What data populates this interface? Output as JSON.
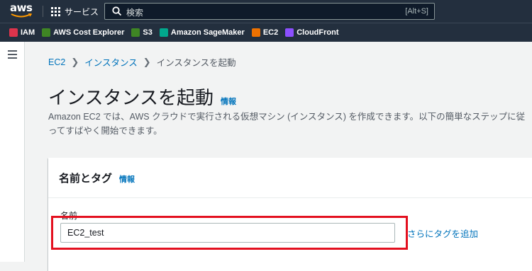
{
  "topbar": {
    "logo_text": "aws",
    "services_label": "サービス",
    "search_placeholder": "検索",
    "search_shortcut": "[Alt+S]"
  },
  "favorites": [
    {
      "label": "IAM",
      "icon": "iam-icon",
      "color": "#dd344c"
    },
    {
      "label": "AWS Cost Explorer",
      "icon": "cost-explorer-icon",
      "color": "#3f8624"
    },
    {
      "label": "S3",
      "icon": "s3-icon",
      "color": "#3f8624"
    },
    {
      "label": "Amazon SageMaker",
      "icon": "sagemaker-icon",
      "color": "#01a88d"
    },
    {
      "label": "EC2",
      "icon": "ec2-icon",
      "color": "#ed7100"
    },
    {
      "label": "CloudFront",
      "icon": "cloudfront-icon",
      "color": "#8c4fff"
    }
  ],
  "breadcrumb": {
    "items": [
      "EC2",
      "インスタンス",
      "インスタンスを起動"
    ]
  },
  "page": {
    "title": "インスタンスを起動",
    "info_label": "情報",
    "description": "Amazon EC2 では、AWS クラウドで実行される仮想マシン (インスタンス) を作成できます。以下の簡単なステップに従ってすばやく開始できます。"
  },
  "panel": {
    "title": "名前とタグ",
    "info_label": "情報",
    "field_label": "名前",
    "name_value": "EC2_test",
    "add_tag_label": "さらにタグを追加"
  },
  "colors": {
    "nav_bg": "#232f3e",
    "link": "#0073bb",
    "highlight": "#e3101f"
  }
}
